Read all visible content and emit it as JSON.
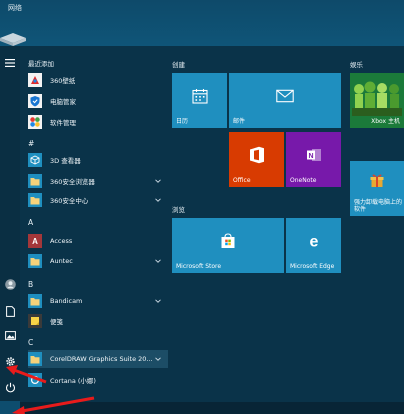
{
  "desktop": {
    "label": "网络"
  },
  "sections": {
    "recent": "最近添加",
    "hash": "#",
    "a": "A",
    "b": "B",
    "c": "C"
  },
  "apps": {
    "wallpaper": "360壁纸",
    "pcmanager": "电脑管家",
    "softmgr": "软件管理",
    "viewer3d": "3D 查看器",
    "browser360": "360安全浏览器",
    "center360": "360安全中心",
    "access": "Access",
    "auntec": "Auntec",
    "bandicam": "Bandicam",
    "bianqian": "便笺",
    "coreldraw": "CorelDRAW Graphics Suite 20...",
    "cortana": "Cortana (小娜)"
  },
  "groups": {
    "create": "创建",
    "browse": "浏览",
    "entertain": "娱乐"
  },
  "tiles": {
    "calendar": "日历",
    "mail": "邮件",
    "office": "Office",
    "onenote": "OneNote",
    "store": "Microsoft Store",
    "edge": "Microsoft Edge",
    "xbox": "Xbox 主机",
    "recommend": "强力卸载电脑上的软件"
  },
  "colors": {
    "tile_blue": "#1f8fbf",
    "tile_office": "#d83b01",
    "tile_onenote": "#7719aa",
    "annotation_red": "#e81b1b"
  }
}
